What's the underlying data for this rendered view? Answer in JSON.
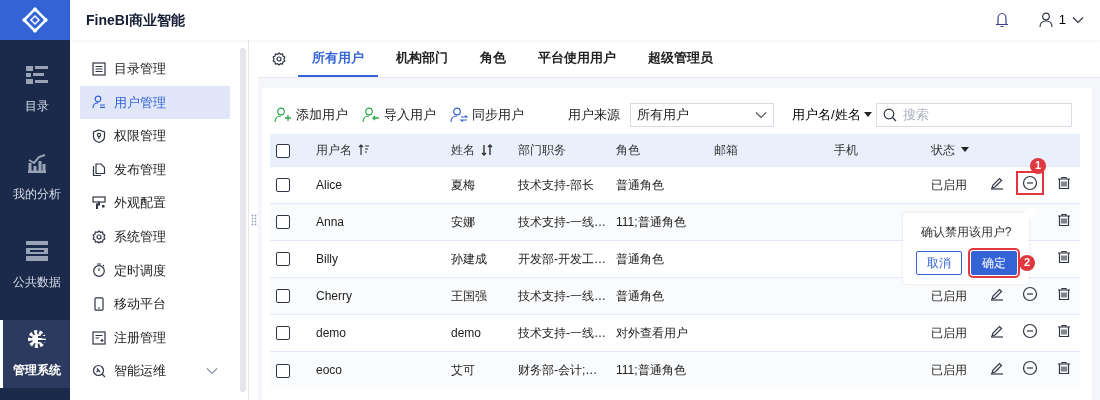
{
  "app": {
    "title": "FineBI商业智能"
  },
  "header": {
    "user": "1"
  },
  "rail": [
    {
      "label": "目录",
      "kind": "catalog",
      "selected": false
    },
    {
      "label": "我的分析",
      "kind": "analysis",
      "selected": false
    },
    {
      "label": "公共数据",
      "kind": "data",
      "selected": false
    },
    {
      "label": "管理系统",
      "kind": "admin",
      "selected": true
    }
  ],
  "menu": [
    {
      "label": "目录管理",
      "kind": "list",
      "selected": false
    },
    {
      "label": "用户管理",
      "kind": "user",
      "selected": true
    },
    {
      "label": "权限管理",
      "kind": "shield",
      "selected": false
    },
    {
      "label": "发布管理",
      "kind": "pages",
      "selected": false
    },
    {
      "label": "外观配置",
      "kind": "brush",
      "selected": false
    },
    {
      "label": "系统管理",
      "kind": "gear",
      "selected": false
    },
    {
      "label": "定时调度",
      "kind": "timer",
      "selected": false
    },
    {
      "label": "移动平台",
      "kind": "phone",
      "selected": false
    },
    {
      "label": "注册管理",
      "kind": "register",
      "selected": false
    },
    {
      "label": "智能运维",
      "kind": "ops",
      "selected": false,
      "expanded": false
    }
  ],
  "tabs": [
    {
      "label": "所有用户",
      "selected": true
    },
    {
      "label": "机构部门",
      "selected": false
    },
    {
      "label": "角色",
      "selected": false
    },
    {
      "label": "平台使用用户",
      "selected": false
    },
    {
      "label": "超级管理员",
      "selected": false
    }
  ],
  "toolbar": {
    "actions": [
      {
        "label": "添加用户",
        "kind": "add"
      },
      {
        "label": "导入用户",
        "kind": "import"
      },
      {
        "label": "同步用户",
        "kind": "sync"
      }
    ],
    "source_label": "用户来源",
    "source_value": "所有用户",
    "search_scope": "用户名/姓名",
    "search_placeholder": "搜索"
  },
  "table": {
    "all_checked": false,
    "columns": [
      {
        "label": "用户名",
        "kind": "sort-filter"
      },
      {
        "label": "姓名",
        "kind": "sort-both"
      },
      {
        "label": "部门职务",
        "kind": "plain"
      },
      {
        "label": "角色",
        "kind": "plain"
      },
      {
        "label": "邮箱",
        "kind": "plain"
      },
      {
        "label": "手机",
        "kind": "plain"
      },
      {
        "label": "状态",
        "kind": "dropdown"
      }
    ],
    "rows": [
      {
        "checked": false,
        "username": "Alice",
        "name": "夏梅",
        "dept": "技术支持-部长",
        "role": "普通角色",
        "status": "已启用",
        "actions": [
          {
            "kind": "edit"
          },
          {
            "kind": "disable",
            "marked": true,
            "callout": "1"
          },
          {
            "kind": "delete"
          }
        ]
      },
      {
        "checked": false,
        "username": "Anna",
        "name": "安娜",
        "dept": "技术支持-一线…",
        "role": "111;普通角色",
        "actions": [
          {
            "kind": "delete"
          }
        ]
      },
      {
        "checked": false,
        "username": "Billy",
        "name": "孙建成",
        "dept": "开发部-开发工…",
        "role": "普通角色",
        "actions": [
          {
            "kind": "delete"
          }
        ]
      },
      {
        "checked": false,
        "username": "Cherry",
        "name": "王国强",
        "dept": "技术支持-一线…",
        "role": "普通角色",
        "status": "已启用",
        "actions": [
          {
            "kind": "edit"
          },
          {
            "kind": "disable"
          },
          {
            "kind": "delete"
          }
        ]
      },
      {
        "checked": false,
        "username": "demo",
        "name": "demo",
        "dept": "技术支持-一线…",
        "role": "对外查看用户",
        "status": "已启用",
        "actions": [
          {
            "kind": "edit"
          },
          {
            "kind": "disable"
          },
          {
            "kind": "delete"
          }
        ]
      },
      {
        "checked": false,
        "username": "eoco",
        "name": "艾可",
        "dept": "财务部-会计;…",
        "role": "111;普通角色",
        "status": "已启用",
        "actions": [
          {
            "kind": "edit"
          },
          {
            "kind": "disable"
          },
          {
            "kind": "delete"
          }
        ]
      }
    ]
  },
  "popover": {
    "message": "确认禁用该用户?",
    "buttons": [
      {
        "label": "取消",
        "kind": "secondary"
      },
      {
        "label": "确定",
        "kind": "primary",
        "marked": true,
        "callout": "2"
      }
    ]
  }
}
